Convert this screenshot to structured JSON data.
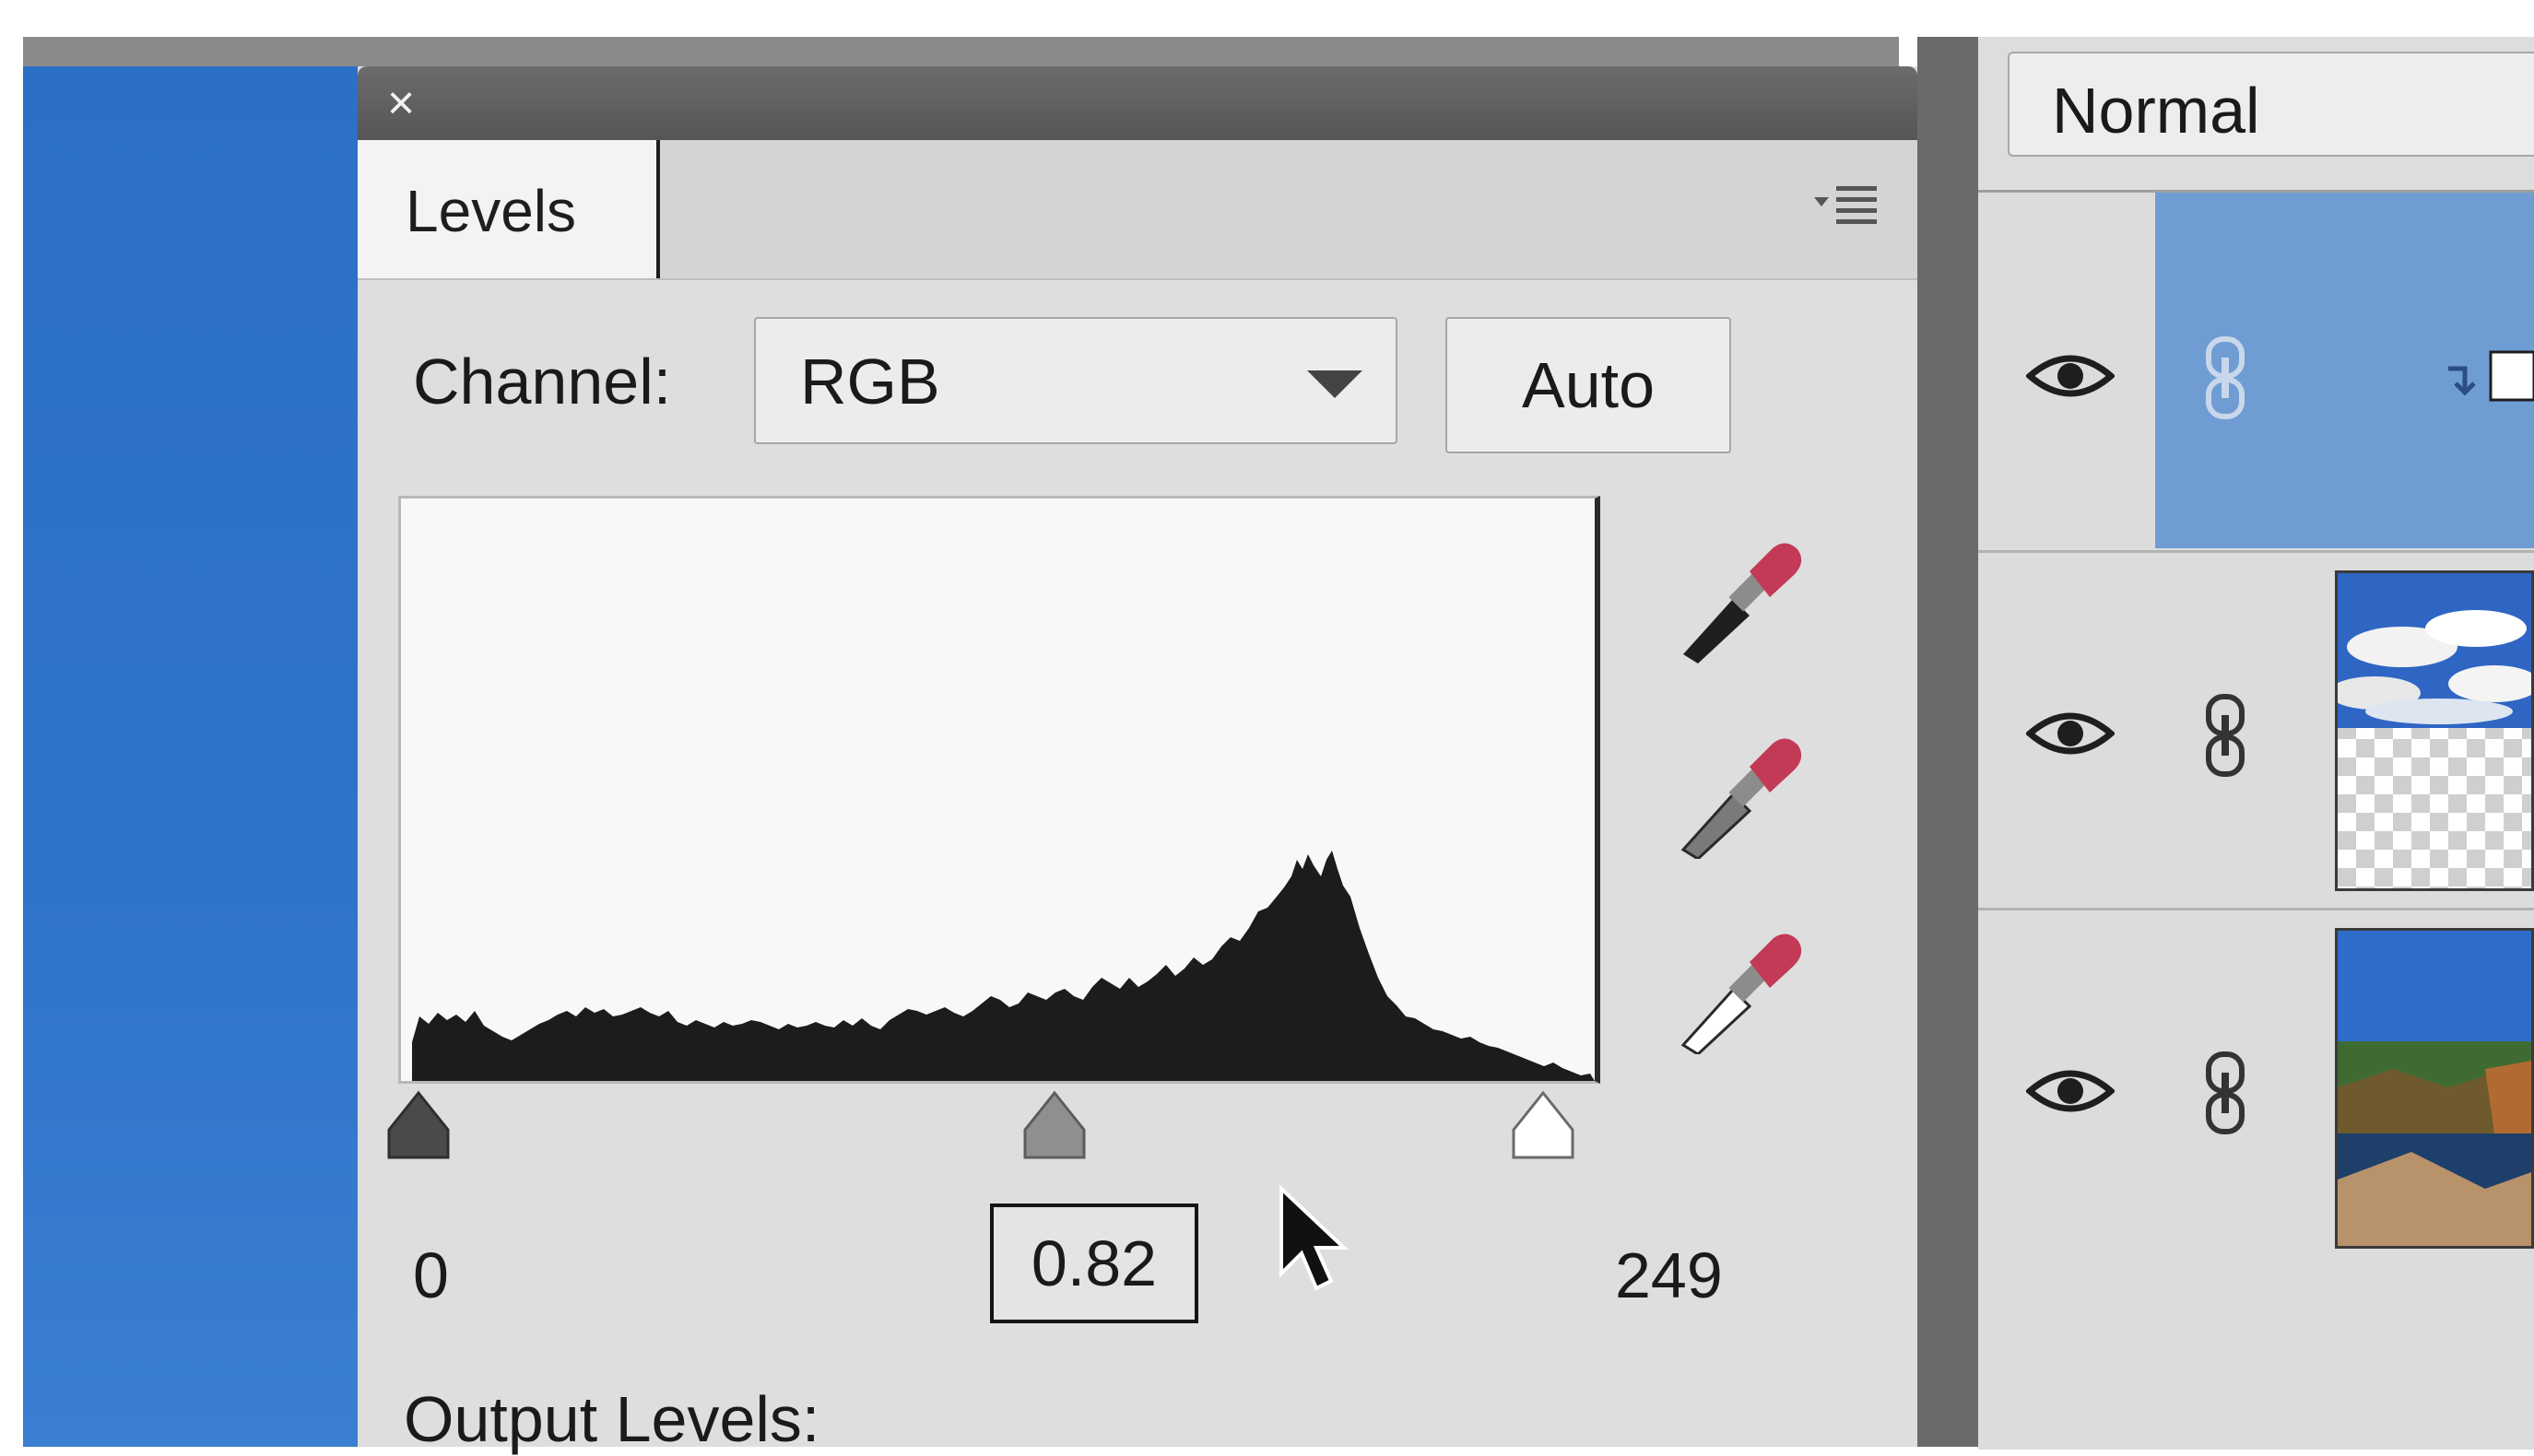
{
  "levels_panel": {
    "close_icon": "close-icon",
    "tab_label": "Levels",
    "menu_icon": "panel-menu-icon",
    "channel_label": "Channel:",
    "channel_value": "RGB",
    "auto_label": "Auto",
    "input_black": "0",
    "input_gamma": "0.82",
    "input_white": "249",
    "output_label": "Output Levels:",
    "eyedroppers": [
      "black-point-eyedropper-icon",
      "gray-point-eyedropper-icon",
      "white-point-eyedropper-icon"
    ]
  },
  "layers_panel": {
    "blend_mode": "Normal",
    "layers": [
      {
        "type": "adjustment",
        "selected": true
      },
      {
        "type": "image",
        "thumbnail": "sky-with-transparency"
      },
      {
        "type": "image",
        "thumbnail": "coastal-landscape"
      }
    ]
  },
  "colors": {
    "panel_bg": "#dedede",
    "selected_layer": "#6f9dd3",
    "canvas_blue": "#2f74cc",
    "dropper_red": "#c23a55"
  }
}
